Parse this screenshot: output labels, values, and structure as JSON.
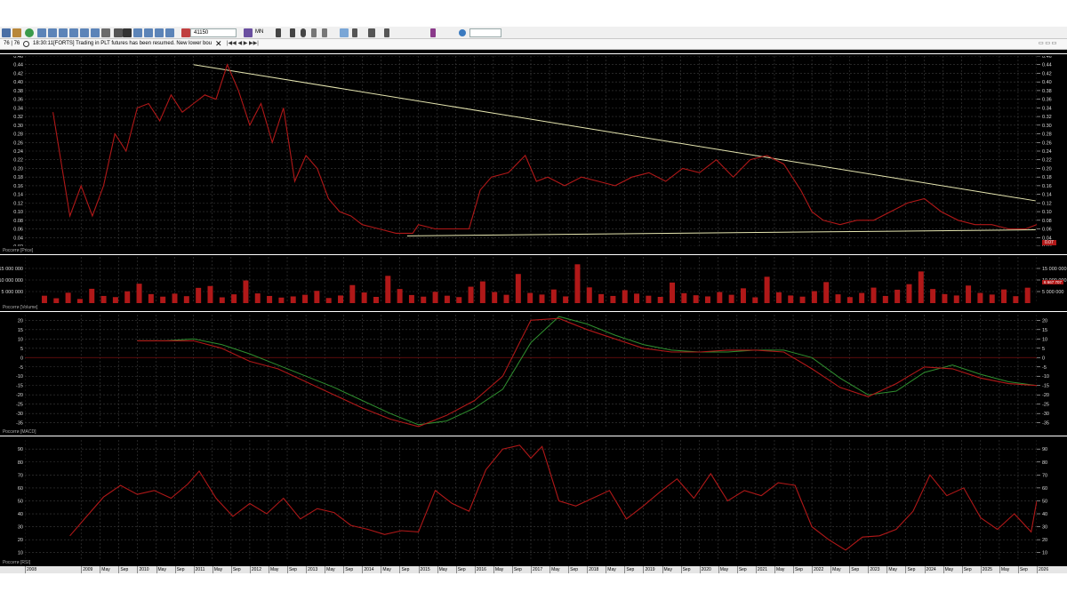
{
  "toolbar": {
    "symbol_value": "41150",
    "timeframe": "MN",
    "search_placeholder": ""
  },
  "newsbar": {
    "scale": "76 | 76",
    "time": "18:30:11",
    "message": "[FORTS] Trading in PLT futures has been resumed. New lower bounds of I"
  },
  "panes": {
    "price_label": "Россети [Price]",
    "price_tag": "0.07",
    "volume_label": "Россети [Volume]",
    "volume_tag": "6 667 707",
    "macd_label": "Россети [MACD]",
    "rsi_label": "Россети [RSI]"
  },
  "colors": {
    "price": "#b01818",
    "trend": "#e6e6b0",
    "signal": "#2f8f2f",
    "grid": "#3c3c3c"
  },
  "x_axis_labels": [
    "2008",
    "2009",
    "May",
    "Sep",
    "2010",
    "May",
    "Sep",
    "2011",
    "May",
    "Sep",
    "2012",
    "May",
    "Sep",
    "2013",
    "May",
    "Sep",
    "2014",
    "May",
    "Sep",
    "2015",
    "May",
    "Sep",
    "2016",
    "May",
    "Sep",
    "2017",
    "May",
    "Sep",
    "2018",
    "May",
    "Sep",
    "2019",
    "May",
    "Sep",
    "2020",
    "May",
    "Sep",
    "2021",
    "May",
    "Sep",
    "2022",
    "May",
    "Sep",
    "2023",
    "May",
    "Sep",
    "2024",
    "May",
    "Sep",
    "2025",
    "May",
    "Sep",
    "2026"
  ],
  "chart_data": [
    {
      "type": "line",
      "title": "Россети [Price]",
      "ylim": [
        0.02,
        0.46
      ],
      "y_ticks": [
        "0.46",
        "0.44",
        "0.42",
        "0.40",
        "0.38",
        "0.36",
        "0.34",
        "0.32",
        "0.30",
        "0.28",
        "0.26",
        "0.24",
        "0.22",
        "0.20",
        "0.18",
        "0.16",
        "0.14",
        "0.12",
        "0.10",
        "0.08",
        "0.06",
        "0.04",
        "0.02"
      ],
      "x": [
        2008.5,
        2008.8,
        2009.0,
        2009.2,
        2009.4,
        2009.6,
        2009.8,
        2010.0,
        2010.2,
        2010.4,
        2010.6,
        2010.8,
        2011.0,
        2011.2,
        2011.4,
        2011.6,
        2011.8,
        2012.0,
        2012.2,
        2012.4,
        2012.6,
        2012.8,
        2013.0,
        2013.2,
        2013.4,
        2013.6,
        2013.8,
        2014.0,
        2014.3,
        2014.6,
        2014.9,
        2015.0,
        2015.3,
        2015.6,
        2015.9,
        2016.1,
        2016.3,
        2016.6,
        2016.9,
        2017.1,
        2017.3,
        2017.6,
        2017.9,
        2018.2,
        2018.5,
        2018.8,
        2019.1,
        2019.4,
        2019.7,
        2020.0,
        2020.3,
        2020.6,
        2020.9,
        2021.2,
        2021.5,
        2021.8,
        2022.0,
        2022.2,
        2022.5,
        2022.8,
        2023.1,
        2023.4,
        2023.7,
        2024.0,
        2024.3,
        2024.6,
        2024.9,
        2025.2,
        2025.5,
        2025.8,
        2026.0
      ],
      "series": [
        {
          "name": "Россети [Price]",
          "values": [
            0.33,
            0.09,
            0.16,
            0.09,
            0.16,
            0.28,
            0.24,
            0.34,
            0.35,
            0.31,
            0.37,
            0.33,
            0.35,
            0.37,
            0.36,
            0.44,
            0.38,
            0.3,
            0.35,
            0.26,
            0.34,
            0.17,
            0.23,
            0.2,
            0.13,
            0.1,
            0.09,
            0.07,
            0.06,
            0.05,
            0.05,
            0.07,
            0.06,
            0.06,
            0.06,
            0.15,
            0.18,
            0.19,
            0.23,
            0.17,
            0.18,
            0.16,
            0.18,
            0.17,
            0.16,
            0.18,
            0.19,
            0.17,
            0.2,
            0.19,
            0.22,
            0.18,
            0.22,
            0.23,
            0.21,
            0.15,
            0.1,
            0.08,
            0.07,
            0.08,
            0.08,
            0.1,
            0.12,
            0.13,
            0.1,
            0.08,
            0.07,
            0.07,
            0.06,
            0.06,
            0.07
          ]
        },
        {
          "name": "",
          "values": []
        }
      ],
      "trendlines": [
        {
          "from": [
            2011.0,
            0.44
          ],
          "to": [
            2025.98,
            0.125
          ]
        },
        {
          "from": [
            2014.8,
            0.044
          ],
          "to": [
            2025.98,
            0.058
          ]
        }
      ]
    },
    {
      "type": "bar",
      "title": "Россети [Volume]",
      "ylim": [
        0,
        20000000
      ],
      "y_ticks": [
        "15 000 000",
        "10 000 000",
        "5 000 000"
      ],
      "series": [
        {
          "name": "Россети [Volume]",
          "values": [
            3200000,
            2100000,
            4500000,
            1800000,
            6200000,
            3100000,
            2600000,
            5100000,
            8400000,
            3900000,
            2800000,
            4100000,
            3000000,
            6600000,
            7400000,
            2500000,
            3800000,
            9800000,
            4200000,
            3100000,
            2400000,
            2900000,
            3600000,
            5300000,
            2200000,
            3300000,
            7800000,
            4600000,
            2700000,
            11800000,
            6100000,
            3500000,
            2800000,
            4900000,
            3200000,
            2600000,
            7100000,
            9400000,
            4800000,
            3600000,
            12600000,
            4400000,
            3700000,
            5900000,
            2900000,
            16800000,
            6800000,
            3900000,
            3100000,
            5600000,
            4100000,
            3200000,
            2700000,
            8900000,
            4300000,
            3400000,
            2900000,
            4800000,
            3600000,
            6400000,
            2500000,
            11400000,
            4700000,
            3300000,
            2800000,
            5200000,
            9100000,
            3800000,
            2600000,
            4400000,
            6700000,
            3100000,
            5800000,
            8200000,
            13700000,
            6100000,
            3900000,
            3300000,
            7600000,
            4400000,
            3700000,
            5900000,
            3000000,
            6667707
          ]
        }
      ]
    },
    {
      "type": "line",
      "title": "Россети [MACD]",
      "ylim": [
        -38,
        23
      ],
      "y_ticks": [
        "20",
        "15",
        "10",
        "5",
        "0",
        "-5",
        "-10",
        "-15",
        "-20",
        "-25",
        "-30",
        "-35"
      ],
      "x": [
        2010.0,
        2010.5,
        2011.0,
        2011.5,
        2012.0,
        2012.5,
        2013.0,
        2013.5,
        2014.0,
        2014.5,
        2015.0,
        2015.5,
        2016.0,
        2016.5,
        2017.0,
        2017.5,
        2018.0,
        2018.5,
        2019.0,
        2019.5,
        2020.0,
        2020.5,
        2021.0,
        2021.5,
        2022.0,
        2022.5,
        2023.0,
        2023.5,
        2024.0,
        2024.5,
        2025.0,
        2025.5,
        2026.0
      ],
      "series": [
        {
          "name": "MACD",
          "values": [
            9,
            9,
            9,
            5,
            -2,
            -6,
            -13,
            -20,
            -27,
            -33,
            -37,
            -31,
            -23,
            -10,
            20,
            21,
            15,
            10,
            5,
            3,
            3,
            4,
            4,
            3,
            -6,
            -16,
            -21,
            -14,
            -5,
            -6,
            -11,
            -14,
            -15
          ]
        },
        {
          "name": "Signal",
          "values": [
            9,
            9,
            10,
            7,
            2,
            -4,
            -10,
            -16,
            -23,
            -30,
            -36,
            -34,
            -27,
            -17,
            8,
            22,
            18,
            12,
            7,
            4,
            3,
            3,
            4,
            4,
            0,
            -11,
            -20,
            -18,
            -8,
            -4,
            -9,
            -13,
            -15
          ]
        }
      ]
    },
    {
      "type": "line",
      "title": "Россети [RSI]",
      "ylim": [
        5,
        97
      ],
      "y_ticks": [
        "90",
        "80",
        "70",
        "60",
        "50",
        "40",
        "30",
        "20",
        "10"
      ],
      "x": [
        2008.8,
        2009.1,
        2009.4,
        2009.7,
        2010.0,
        2010.3,
        2010.6,
        2010.9,
        2011.1,
        2011.4,
        2011.7,
        2012.0,
        2012.3,
        2012.6,
        2012.9,
        2013.2,
        2013.5,
        2013.8,
        2014.1,
        2014.4,
        2014.7,
        2015.0,
        2015.3,
        2015.6,
        2015.9,
        2016.2,
        2016.5,
        2016.8,
        2017.0,
        2017.2,
        2017.5,
        2017.8,
        2018.1,
        2018.4,
        2018.7,
        2019.0,
        2019.3,
        2019.6,
        2019.9,
        2020.2,
        2020.5,
        2020.8,
        2021.1,
        2021.4,
        2021.7,
        2022.0,
        2022.3,
        2022.6,
        2022.9,
        2023.2,
        2023.5,
        2023.8,
        2024.1,
        2024.4,
        2024.7,
        2025.0,
        2025.3,
        2025.6,
        2025.9,
        2026.0
      ],
      "series": [
        {
          "name": "Россети [RSI]",
          "values": [
            23,
            38,
            53,
            62,
            55,
            58,
            52,
            63,
            73,
            52,
            38,
            48,
            40,
            52,
            36,
            44,
            41,
            31,
            28,
            24,
            27,
            26,
            58,
            48,
            42,
            74,
            90,
            93,
            83,
            92,
            50,
            46,
            52,
            58,
            36,
            46,
            57,
            67,
            52,
            71,
            50,
            58,
            54,
            64,
            62,
            30,
            20,
            12,
            22,
            23,
            28,
            42,
            70,
            54,
            60,
            37,
            28,
            40,
            26,
            50
          ]
        }
      ]
    }
  ]
}
